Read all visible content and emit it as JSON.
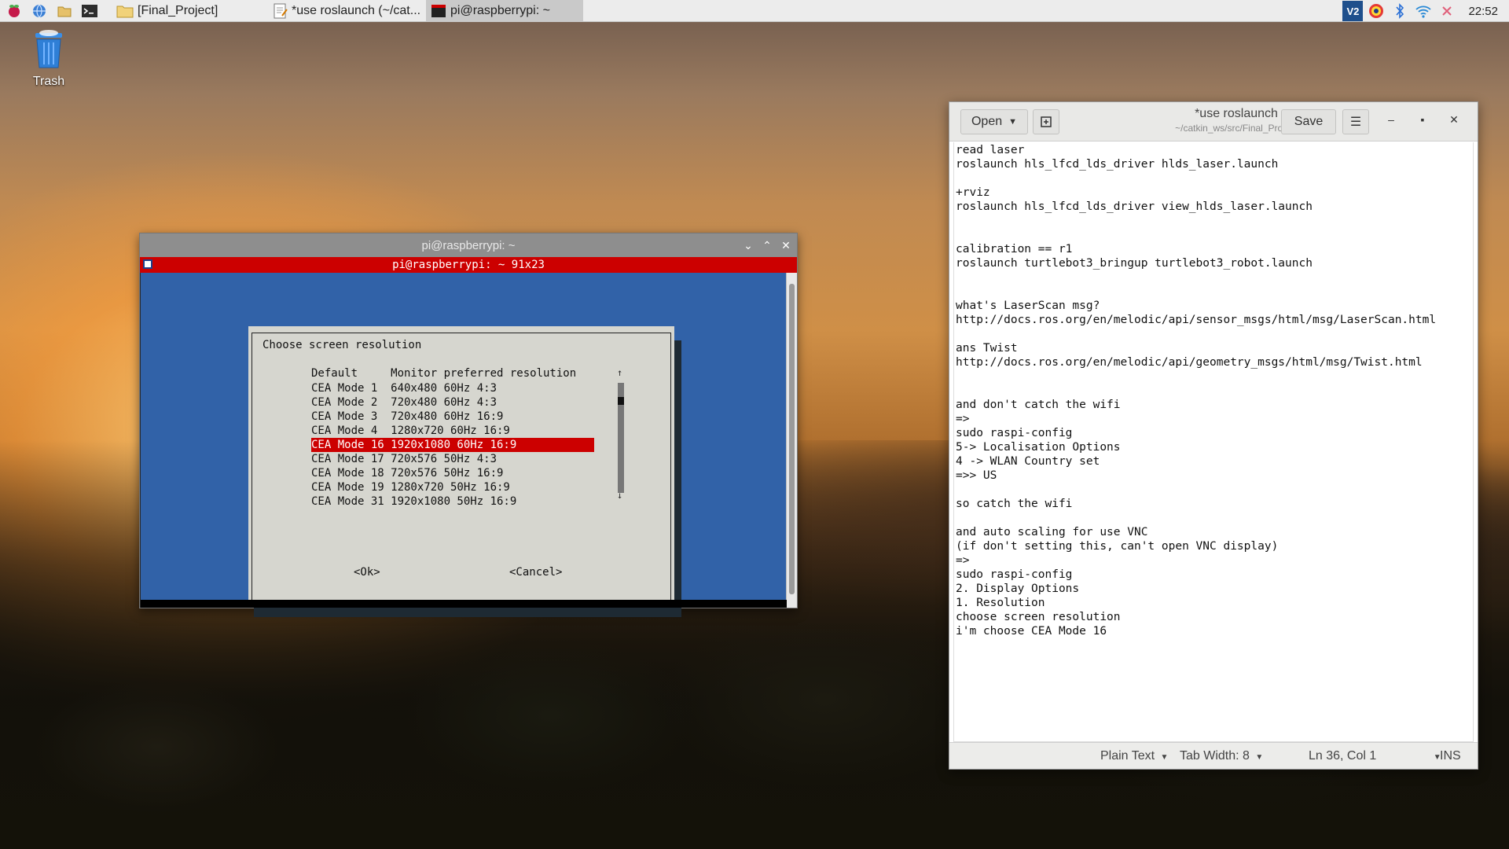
{
  "taskbar": {
    "launchers": [
      "raspberry-menu",
      "web-browser",
      "file-manager",
      "terminal"
    ],
    "tasks": [
      {
        "label": "[Final_Project]",
        "icon": "folder-icon"
      },
      {
        "label": "*use roslaunch (~/cat...",
        "icon": "text-editor-icon"
      },
      {
        "label": "pi@raspberrypi: ~",
        "icon": "terminal-icon"
      }
    ],
    "tray": {
      "vnc_label": "V2"
    },
    "clock": "22:52"
  },
  "desktop": {
    "trash_label": "Trash"
  },
  "terminal": {
    "window_title": "pi@raspberrypi: ~",
    "inner_title": "pi@raspberrypi: ~ 91x23",
    "dialog": {
      "title": "Choose screen resolution",
      "options": [
        "Default     Monitor preferred resolution",
        "CEA Mode 1  640x480 60Hz 4:3",
        "CEA Mode 2  720x480 60Hz 4:3",
        "CEA Mode 3  720x480 60Hz 16:9",
        "CEA Mode 4  1280x720 60Hz 16:9",
        "CEA Mode 16 1920x1080 60Hz 16:9",
        "CEA Mode 17 720x576 50Hz 4:3",
        "CEA Mode 18 720x576 50Hz 16:9",
        "CEA Mode 19 1280x720 50Hz 16:9",
        "CEA Mode 31 1920x1080 50Hz 16:9"
      ],
      "selected_index": 5,
      "ok_label": "<Ok>",
      "cancel_label": "<Cancel>",
      "scroll_up": "↑",
      "scroll_down": "↓"
    }
  },
  "editor": {
    "buttons": {
      "open": "Open",
      "save": "Save"
    },
    "title": "*use roslaunch",
    "subtitle": "~/catkin_ws/src/Final_Project",
    "lines": [
      "read laser",
      "roslaunch hls_lfcd_lds_driver hlds_laser.launch",
      "",
      "+rviz",
      "roslaunch hls_lfcd_lds_driver view_hlds_laser.launch",
      "",
      "",
      "calibration == r1",
      "roslaunch turtlebot3_bringup turtlebot3_robot.launch",
      "",
      "",
      "what's LaserScan msg?",
      "http://docs.ros.org/en/melodic/api/sensor_msgs/html/msg/LaserScan.html",
      "",
      "ans Twist",
      "http://docs.ros.org/en/melodic/api/geometry_msgs/html/msg/Twist.html",
      "",
      "",
      "and don't catch the wifi",
      "=>",
      "sudo raspi-config",
      "5-> Localisation Options",
      "4 -> WLAN Country set",
      "=>> US",
      "",
      "so catch the wifi",
      "",
      "and auto scaling for use VNC",
      "(if don't setting this, can't open VNC display)",
      "=>",
      "sudo raspi-config",
      "2. Display Options",
      "1. Resolution",
      "choose screen resolution",
      "i'm choose CEA Mode 16"
    ],
    "status": {
      "language": "Plain Text",
      "tab_width": "Tab Width: 8",
      "position": "Ln 36, Col 1",
      "mode": "INS"
    }
  },
  "colors": {
    "terminal_blue": "#3162a8",
    "selection_red": "#cc0000",
    "dialog_gray": "#d6d6cf"
  }
}
